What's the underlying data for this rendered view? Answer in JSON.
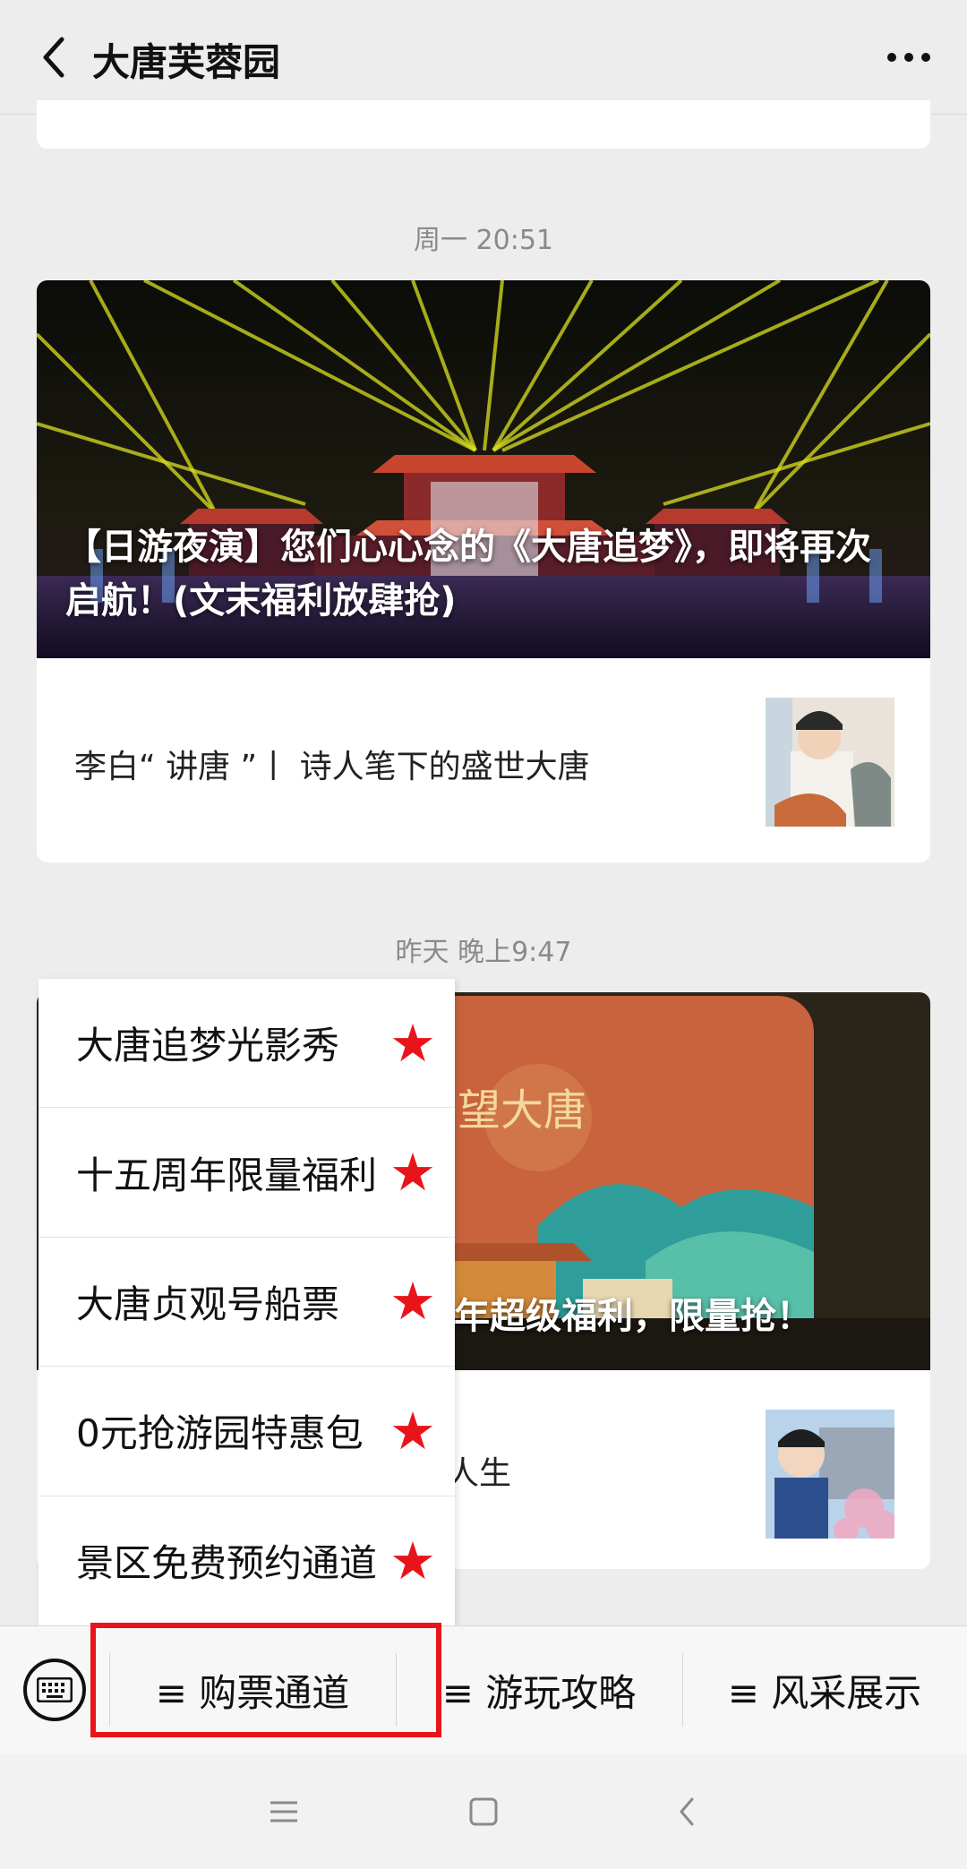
{
  "header": {
    "title": "大唐芙蓉园"
  },
  "feed": [
    {
      "timestamp": "周一 20:51",
      "hero_title": "【日游夜演】您们心心念的《大唐追梦》，即将再次启航！(文末福利放肆抢)",
      "sub_title": "李白“ 讲唐 ”丨 诗人笔下的盛世大唐"
    },
    {
      "timestamp": "昨天 晚上9:47",
      "hero_title_visible": "年超级福利，限量抢！",
      "sub_title_visible": "人生",
      "poster_text": "望大唐"
    }
  ],
  "popup_menu": {
    "items": [
      {
        "label": "大唐追梦光影秀",
        "star": "★"
      },
      {
        "label": "十五周年限量福利",
        "star": "★"
      },
      {
        "label": "大唐贞观号船票",
        "star": "★"
      },
      {
        "label": "0元抢游园特惠包",
        "star": "★"
      },
      {
        "label": "景区免费预约通道",
        "star": "★"
      }
    ]
  },
  "menu_bar": {
    "tabs": [
      {
        "label": "≡ 购票通道"
      },
      {
        "label": "≡ 游玩攻略"
      },
      {
        "label": "≡ 风采展示"
      }
    ]
  },
  "colors": {
    "accent_red": "#e8141a",
    "background": "#ededed"
  },
  "icons": [
    "back-arrow-icon",
    "more-dots-icon",
    "keyboard-icon",
    "nav-menu-icon",
    "nav-home-icon",
    "nav-back-icon"
  ]
}
